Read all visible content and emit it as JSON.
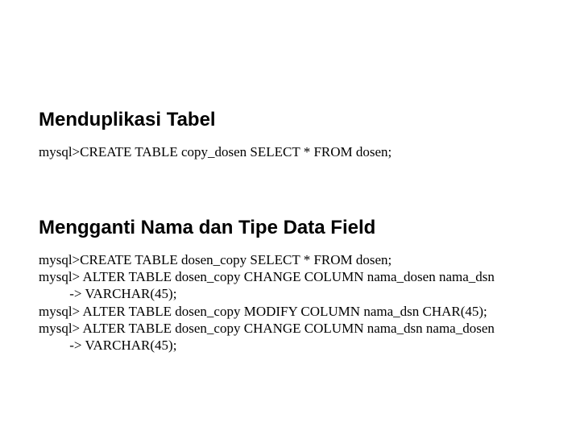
{
  "section1": {
    "heading": "Menduplikasi Tabel",
    "code": "mysql>CREATE TABLE copy_dosen SELECT * FROM dosen;"
  },
  "section2": {
    "heading": "Mengganti Nama dan Tipe Data Field",
    "code": "mysql>CREATE TABLE dosen_copy SELECT * FROM dosen;\nmysql> ALTER TABLE dosen_copy CHANGE COLUMN nama_dosen nama_dsn\n         -> VARCHAR(45);\nmysql> ALTER TABLE dosen_copy MODIFY COLUMN nama_dsn CHAR(45);\nmysql> ALTER TABLE dosen_copy CHANGE COLUMN nama_dsn nama_dosen\n         -> VARCHAR(45);"
  }
}
